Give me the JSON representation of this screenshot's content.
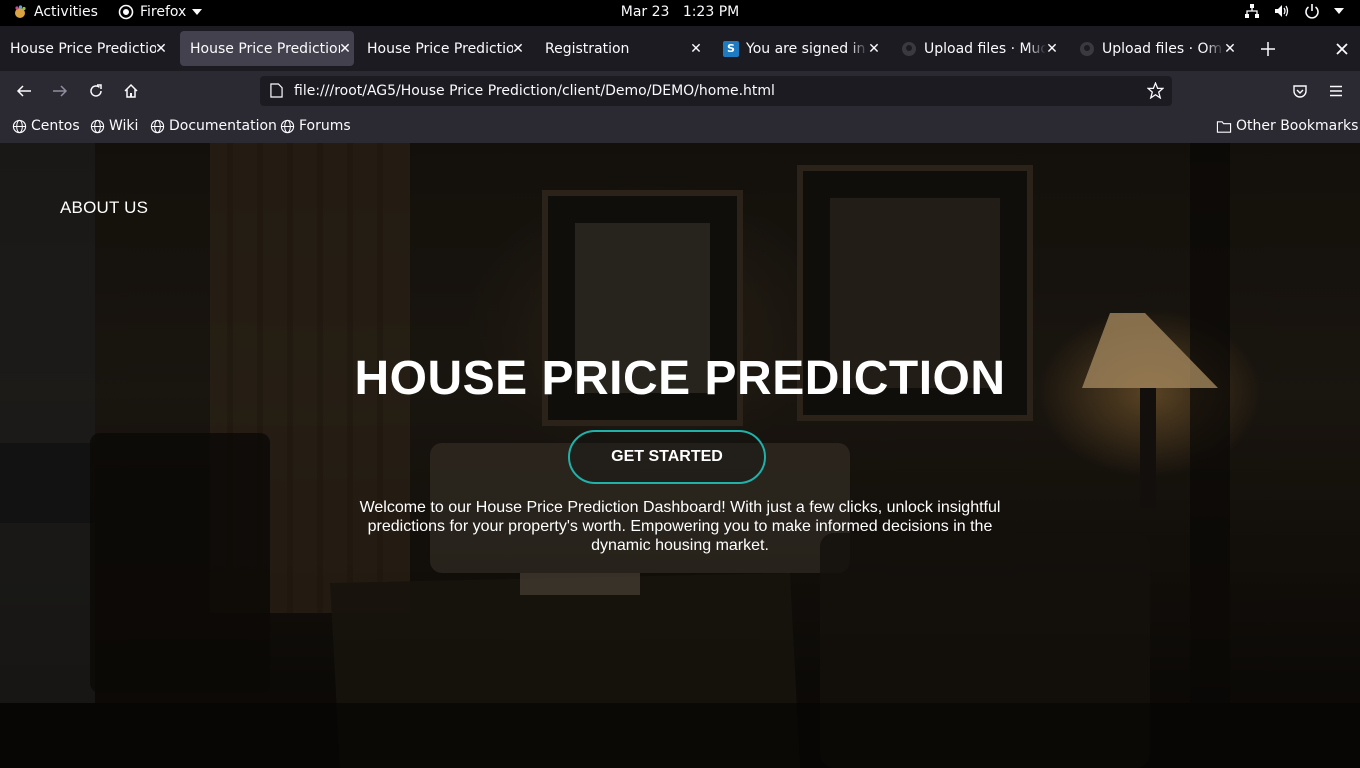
{
  "system": {
    "activities_label": "Activities",
    "app_name": "Firefox",
    "date": "Mar 23",
    "time": "1:23 PM"
  },
  "tabs": [
    {
      "title": "House Price Prediction",
      "active": false
    },
    {
      "title": "House Price Prediction",
      "active": true
    },
    {
      "title": "House Price Prediction",
      "active": false
    },
    {
      "title": "Registration",
      "active": false
    },
    {
      "title": "You are signed in a",
      "active": false,
      "favicon": "S"
    },
    {
      "title": "Upload files · Muda",
      "active": false
    },
    {
      "title": "Upload files · OmS",
      "active": false
    }
  ],
  "url": "file:///root/AG5/House Price Prediction/client/Demo/DEMO/home.html",
  "bookmarks": {
    "items": [
      "Centos",
      "Wiki",
      "Documentation",
      "Forums"
    ],
    "other": "Other Bookmarks"
  },
  "page": {
    "nav_about": "ABOUT US",
    "title": "HOUSE PRICE PREDICTION",
    "cta_label": "GET STARTED",
    "description": "Welcome to our House Price Prediction Dashboard! With just a few clicks, unlock insightful predictions for your property's worth. Empowering you to make informed decisions in the dynamic housing market.",
    "accent_color": "#20b2aa"
  }
}
